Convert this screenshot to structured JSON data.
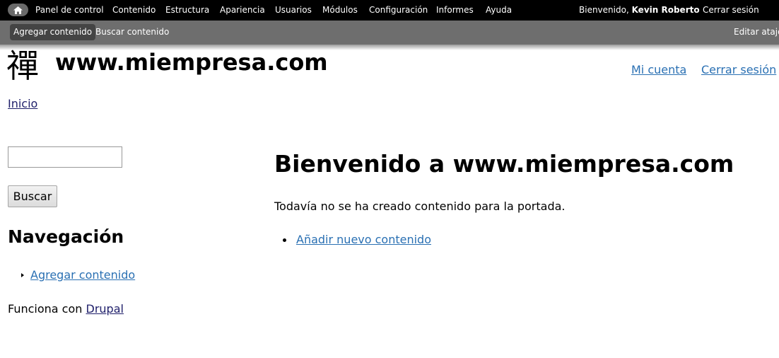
{
  "toolbar": {
    "home_icon": "home-icon",
    "menu": [
      "Panel de control",
      "Contenido",
      "Estructura",
      "Apariencia",
      "Usuarios",
      "Módulos",
      "Configuración",
      "Informes",
      "Ayuda"
    ],
    "welcome_prefix": "Bienvenido,",
    "user_name": "Kevin Roberto",
    "logout": "Cerrar sesión"
  },
  "shortcuts": {
    "items": [
      "Agregar contenido",
      "Buscar contenido"
    ],
    "edit": "Editar atajos"
  },
  "header": {
    "logo_glyph": "禪",
    "site_name": "www.miempresa.com",
    "my_account": "Mi cuenta",
    "logout": "Cerrar sesión"
  },
  "breadcrumb": {
    "home": "Inicio"
  },
  "sidebar": {
    "search_value": "",
    "search_button": "Buscar",
    "nav_heading": "Navegación",
    "nav_items": [
      "Agregar contenido"
    ],
    "powered_prefix": "Funciona con",
    "powered_link": "Drupal"
  },
  "main": {
    "title": "Bienvenido a www.miempresa.com",
    "text": "Todavía no se ha creado contenido para la portada.",
    "links": [
      "Añadir nuevo contenido"
    ]
  }
}
